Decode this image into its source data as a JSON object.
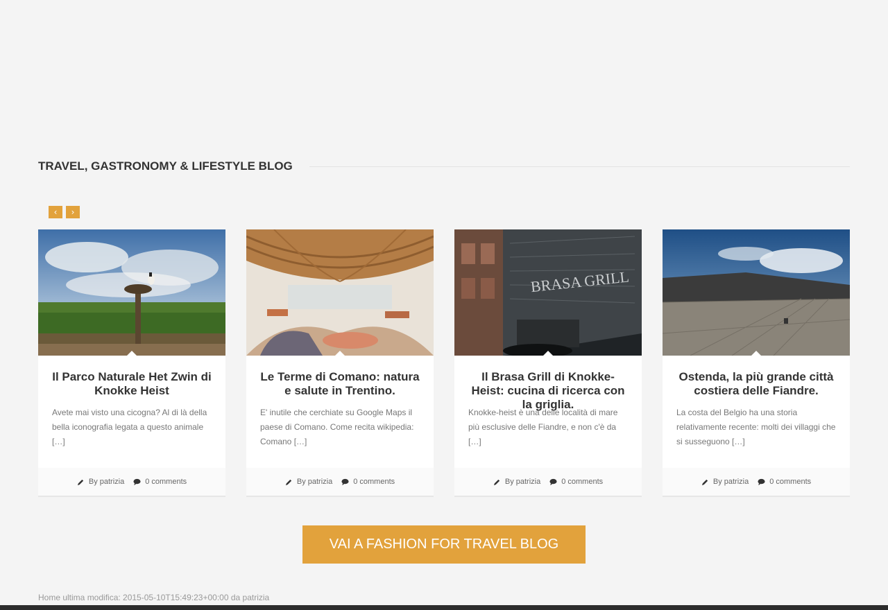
{
  "section": {
    "title": "TRAVEL, GASTRONOMY & LIFESTYLE BLOG"
  },
  "nav": {
    "prev": "‹",
    "next": "›"
  },
  "posts": [
    {
      "title": "Il Parco Naturale Het Zwin di Knokke Heist",
      "excerpt": "Avete mai visto una cicogna? Al di là della bella iconografia legata a questo animale […]",
      "author": "By patrizia",
      "comments": "0 comments"
    },
    {
      "title": "Le Terme di Comano: natura e salute in Trentino.",
      "excerpt": "E' inutile che cerchiate su Google Maps il paese di Comano. Come recita wikipedia: Comano […]",
      "author": "By patrizia",
      "comments": "0 comments"
    },
    {
      "title": "Il Brasa Grill di Knokke-Heist: cucina di ricerca con la griglia.",
      "excerpt": "Knokke-heist è una delle località di mare più esclusive delle Fiandre, e non c'è da […]",
      "author": "By patrizia",
      "comments": "0 comments"
    },
    {
      "title": "Ostenda, la più grande città costiera delle Fiandre.",
      "excerpt": "La costa del Belgio ha una storia relativamente recente: molti dei villaggi che si susseguono […]",
      "author": "By patrizia",
      "comments": "0 comments"
    }
  ],
  "cta": {
    "label": "VAI A FASHION FOR TRAVEL BLOG"
  },
  "footer": {
    "note": "Home ultima modifica: 2015-05-10T15:49:23+00:00 da patrizia"
  },
  "colors": {
    "accent": "#e2a23c",
    "background": "#f4f4f4",
    "bottom_bar": "#2c2c2c"
  }
}
